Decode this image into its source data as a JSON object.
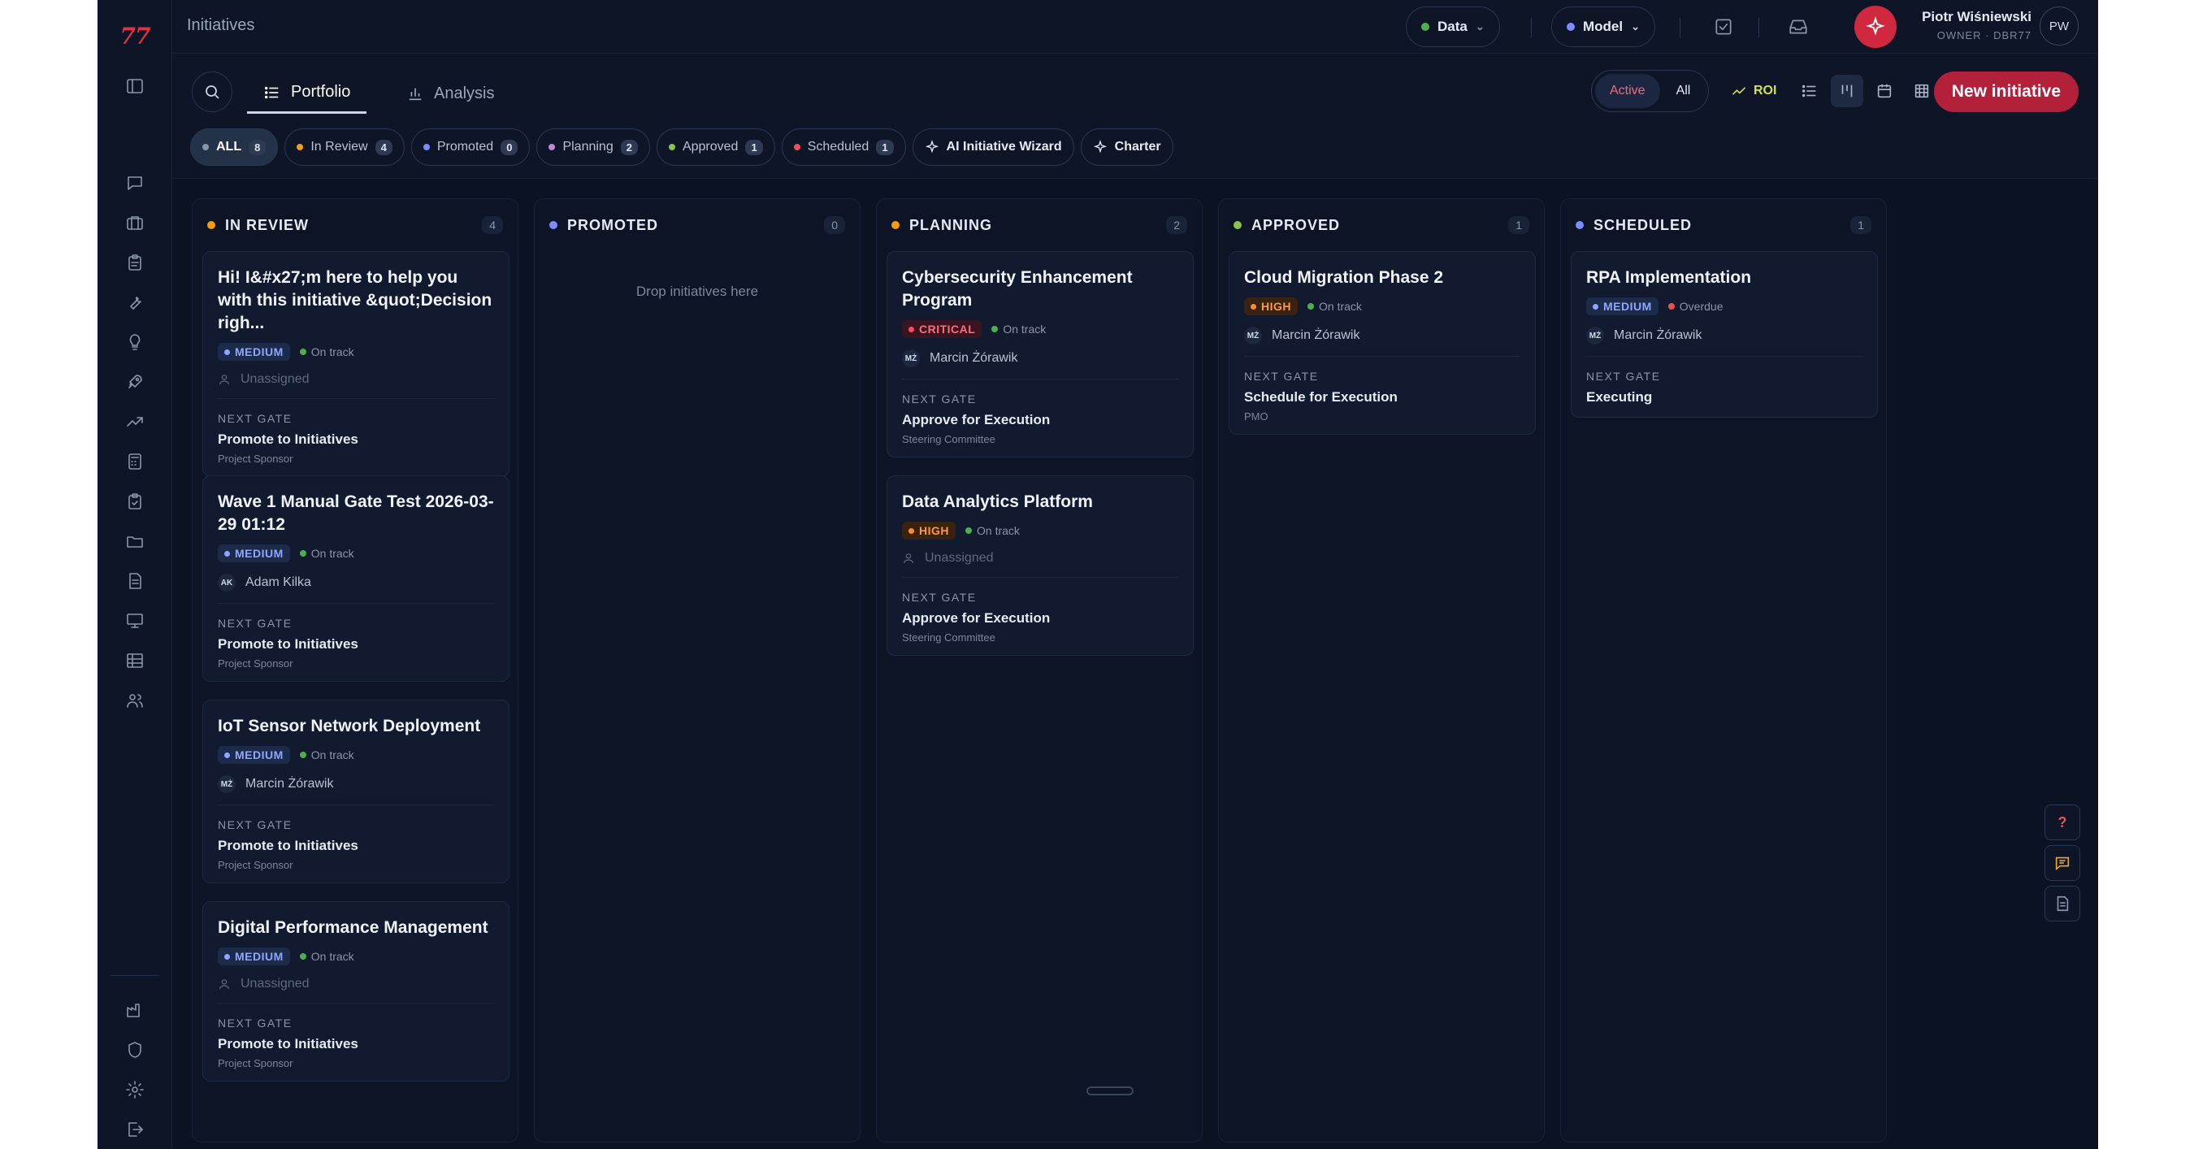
{
  "app": {
    "logo": "77",
    "page_title": "Initiatives"
  },
  "topbar": {
    "data_selector": {
      "label": "Data",
      "dot_color": "#4caf50"
    },
    "model_selector": {
      "label": "Model",
      "dot_color": "#7b8cff"
    },
    "user": {
      "name": "Piotr Wiśniewski",
      "role": "OWNER · DBR77",
      "initials": "PW"
    }
  },
  "tabs": [
    {
      "label": "Portfolio",
      "active": true
    },
    {
      "label": "Analysis",
      "active": false
    }
  ],
  "scope_toggle": {
    "active": "Active",
    "all": "All"
  },
  "roi_label": "ROI",
  "new_button": "New initiative",
  "filters": [
    {
      "label": "ALL",
      "count": "8",
      "color": "#8a95ab"
    },
    {
      "label": "In Review",
      "count": "4",
      "color": "#f59e0b"
    },
    {
      "label": "Promoted",
      "count": "0",
      "color": "#7b8cff"
    },
    {
      "label": "Planning",
      "count": "2",
      "color": "#b98bd6"
    },
    {
      "label": "Approved",
      "count": "1",
      "color": "#8bc34a"
    },
    {
      "label": "Scheduled",
      "count": "1",
      "color": "#ef4c5a"
    }
  ],
  "tools": {
    "wizard": "AI Initiative Wizard",
    "charter": "Charter"
  },
  "columns": [
    {
      "title": "IN REVIEW",
      "count": "4",
      "color": "#f59e0b",
      "cards": [
        {
          "title": "Hi! I&#x27;m here to help you with this initiative &quot;Decision righ...",
          "priority": "MEDIUM",
          "status": "On track",
          "owner": "Unassigned",
          "owner_initials": "",
          "gate_label": "NEXT GATE",
          "gate": "Promote to Initiatives",
          "gate_who": "Project Sponsor"
        },
        {
          "title": "Wave 1 Manual Gate Test 2026-03-29 01:12",
          "priority": "MEDIUM",
          "status": "On track",
          "owner": "Adam Kilka",
          "owner_initials": "AK",
          "gate_label": "NEXT GATE",
          "gate": "Promote to Initiatives",
          "gate_who": "Project Sponsor"
        },
        {
          "title": "IoT Sensor Network Deployment",
          "priority": "MEDIUM",
          "status": "On track",
          "owner": "Marcin Żórawik",
          "owner_initials": "MŻ",
          "gate_label": "NEXT GATE",
          "gate": "Promote to Initiatives",
          "gate_who": "Project Sponsor"
        },
        {
          "title": "Digital Performance Management",
          "priority": "MEDIUM",
          "status": "On track",
          "owner": "Unassigned",
          "owner_initials": "",
          "gate_label": "NEXT GATE",
          "gate": "Promote to Initiatives",
          "gate_who": "Project Sponsor"
        }
      ]
    },
    {
      "title": "PROMOTED",
      "count": "0",
      "color": "#7b8cff",
      "empty_text": "Drop initiatives here",
      "cards": []
    },
    {
      "title": "PLANNING",
      "count": "2",
      "color": "#f59e0b",
      "cards": [
        {
          "title": "Cybersecurity Enhancement Program",
          "priority": "CRITICAL",
          "status": "On track",
          "owner": "Marcin Żórawik",
          "owner_initials": "MŻ",
          "gate_label": "NEXT GATE",
          "gate": "Approve for Execution",
          "gate_who": "Steering Committee"
        },
        {
          "title": "Data Analytics Platform",
          "priority": "HIGH",
          "status": "On track",
          "owner": "Unassigned",
          "owner_initials": "",
          "gate_label": "NEXT GATE",
          "gate": "Approve for Execution",
          "gate_who": "Steering Committee"
        }
      ]
    },
    {
      "title": "APPROVED",
      "count": "1",
      "color": "#8bc34a",
      "cards": [
        {
          "title": "Cloud Migration Phase 2",
          "priority": "HIGH",
          "status": "On track",
          "owner": "Marcin Żórawik",
          "owner_initials": "MŻ",
          "gate_label": "NEXT GATE",
          "gate": "Schedule for Execution",
          "gate_who": "PMO"
        }
      ]
    },
    {
      "title": "SCHEDULED",
      "count": "1",
      "color": "#7b8cff",
      "cards": [
        {
          "title": "RPA Implementation",
          "priority": "MEDIUM",
          "status": "Overdue",
          "owner": "Marcin Żórawik",
          "owner_initials": "MŻ",
          "gate_label": "NEXT GATE",
          "gate": "Executing",
          "gate_who": ""
        }
      ]
    }
  ],
  "help_label": "?"
}
